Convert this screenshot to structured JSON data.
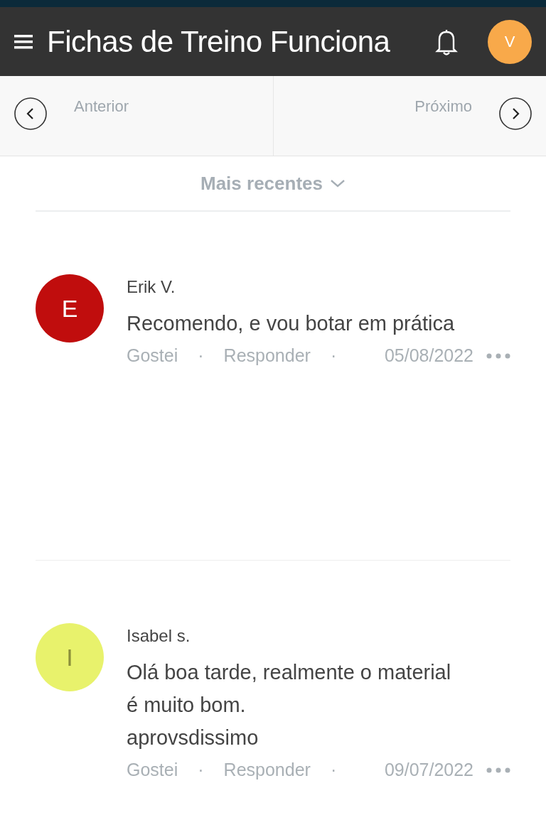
{
  "app_bar": {
    "title": "Fichas de Treino Funciona",
    "avatar_letter": "V"
  },
  "pager": {
    "previous": "Anterior",
    "next": "Próximo"
  },
  "sort": {
    "label": "Mais recentes"
  },
  "comments": [
    {
      "author": "Erik V.",
      "initial": "E",
      "color": "#c00d0d",
      "text": "Recomendo,  e vou botar em prática",
      "like": "Gostei",
      "separator_1": "·",
      "reply": "Responder",
      "separator_2": "·",
      "date": "05/08/2022"
    },
    {
      "author": "Isabel s.",
      "initial": "I",
      "color": "#e8f26c",
      "text": "Olá boa tarde, realmente o material é muito bom.\naprovsdissimo",
      "like": "Gostei",
      "separator_1": "·",
      "reply": "Responder",
      "separator_2": "·",
      "date": "09/07/2022"
    }
  ]
}
